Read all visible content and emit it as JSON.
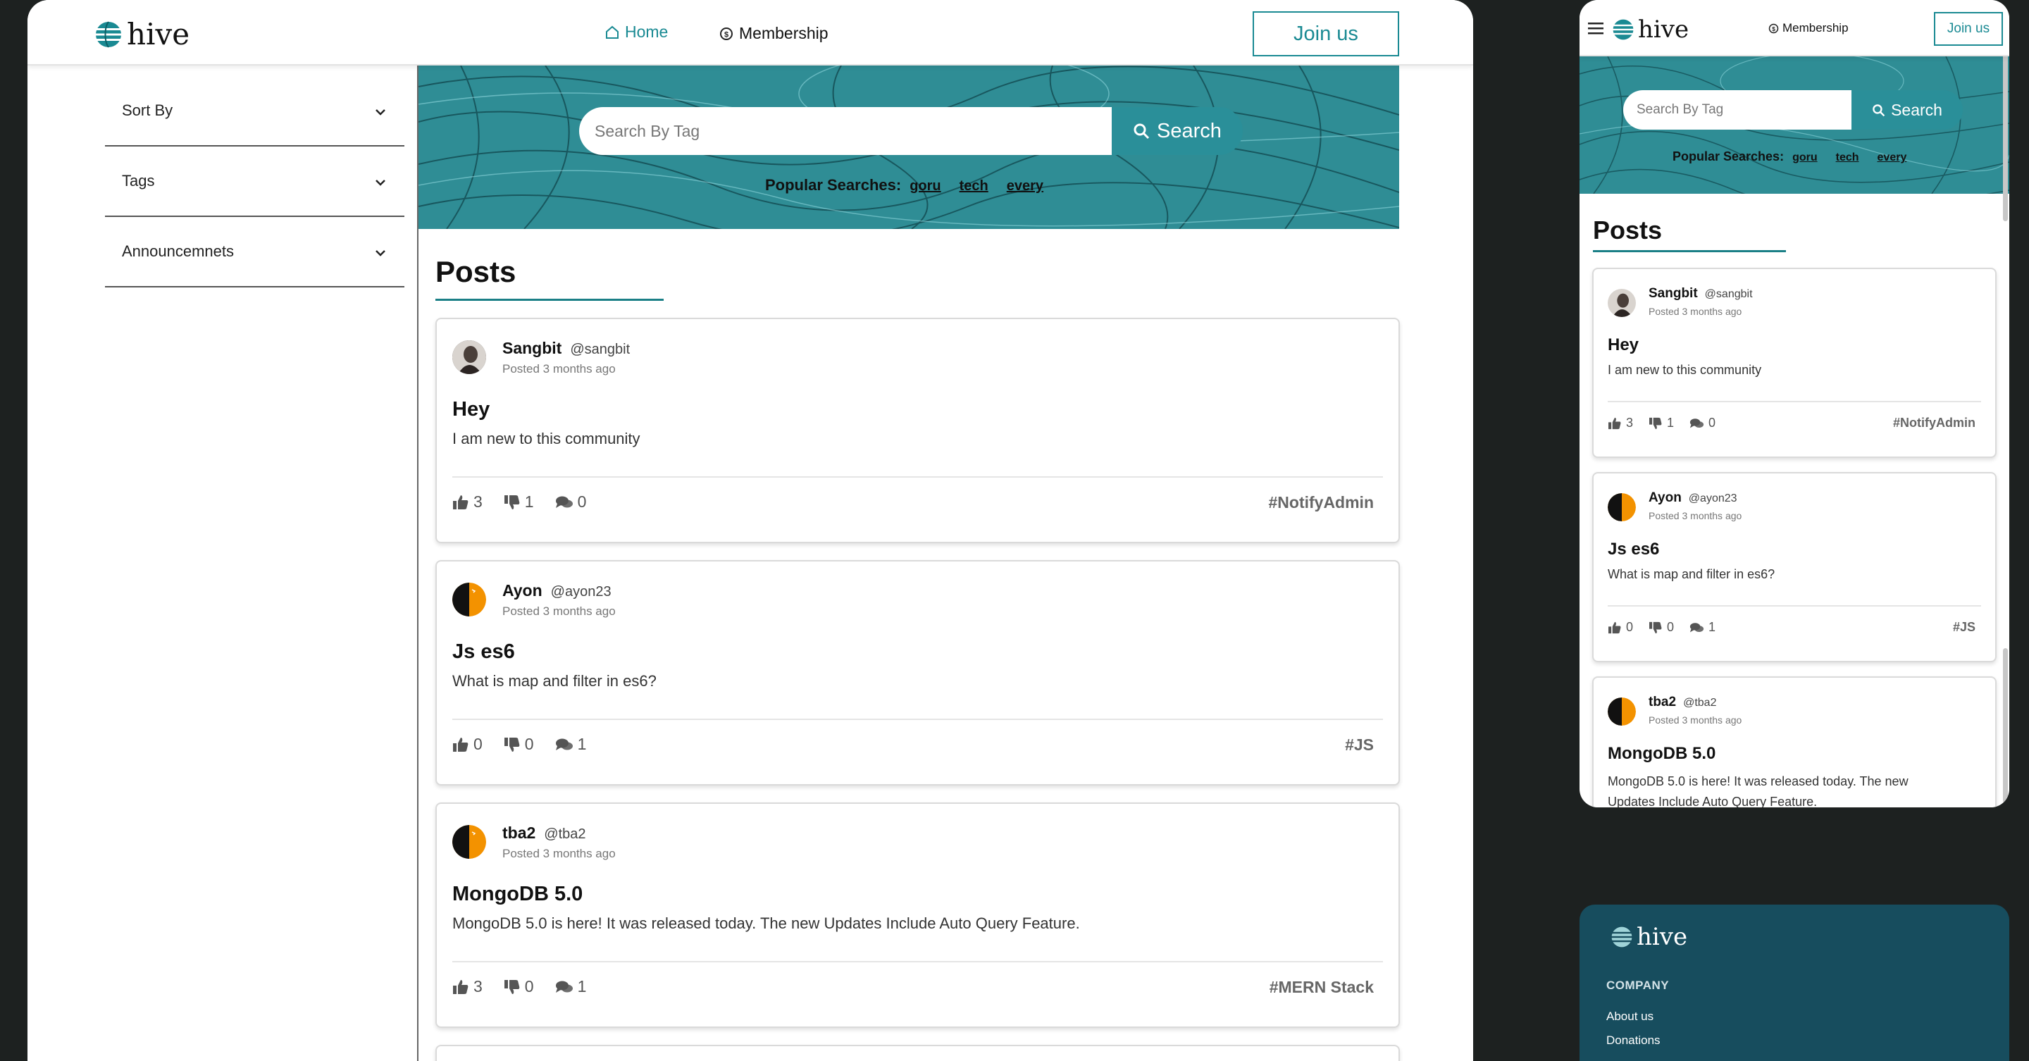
{
  "brand": {
    "name": "hive",
    "accent": "#1a8a93",
    "dark": "#174d5e"
  },
  "nav": {
    "home": "Home",
    "membership": "Membership",
    "join": "Join us"
  },
  "sidebar": {
    "items": [
      {
        "label": "Sort By"
      },
      {
        "label": "Tags"
      },
      {
        "label": "Announcemnets"
      }
    ]
  },
  "search": {
    "placeholder": "Search By Tag",
    "button": "Search"
  },
  "popular": {
    "label": "Popular Searches:",
    "tags": [
      "goru",
      "tech",
      "every"
    ]
  },
  "posts_heading": "Posts",
  "posts": [
    {
      "name": "Sangbit",
      "handle": "@sangbit",
      "posted": "Posted 3 months ago",
      "title": "Hey",
      "body": "I am new to this community",
      "likes": "3",
      "dislikes": "1",
      "comments": "0",
      "tag": "#NotifyAdmin",
      "avatar": "photo"
    },
    {
      "name": "Ayon",
      "handle": "@ayon23",
      "posted": "Posted 3 months ago",
      "title": "Js es6",
      "body": "What is map and filter in es6?",
      "likes": "0",
      "dislikes": "0",
      "comments": "1",
      "tag": "#JS",
      "avatar": "orange"
    },
    {
      "name": "tba2",
      "handle": "@tba2",
      "posted": "Posted 3 months ago",
      "title": "MongoDB 5.0",
      "body": "MongoDB 5.0 is here! It was released today. The new Updates Include Auto Query Feature.",
      "mobile_body_1": "MongoDB 5.0 is here! It was released today. The new",
      "mobile_body_2": "Updates Include Auto Query Feature.",
      "likes": "3",
      "dislikes": "0",
      "comments": "1",
      "tag": "#MERN Stack",
      "avatar": "orange"
    }
  ],
  "footer": {
    "section": "COMPANY",
    "links": [
      "About us",
      "Donations"
    ]
  }
}
